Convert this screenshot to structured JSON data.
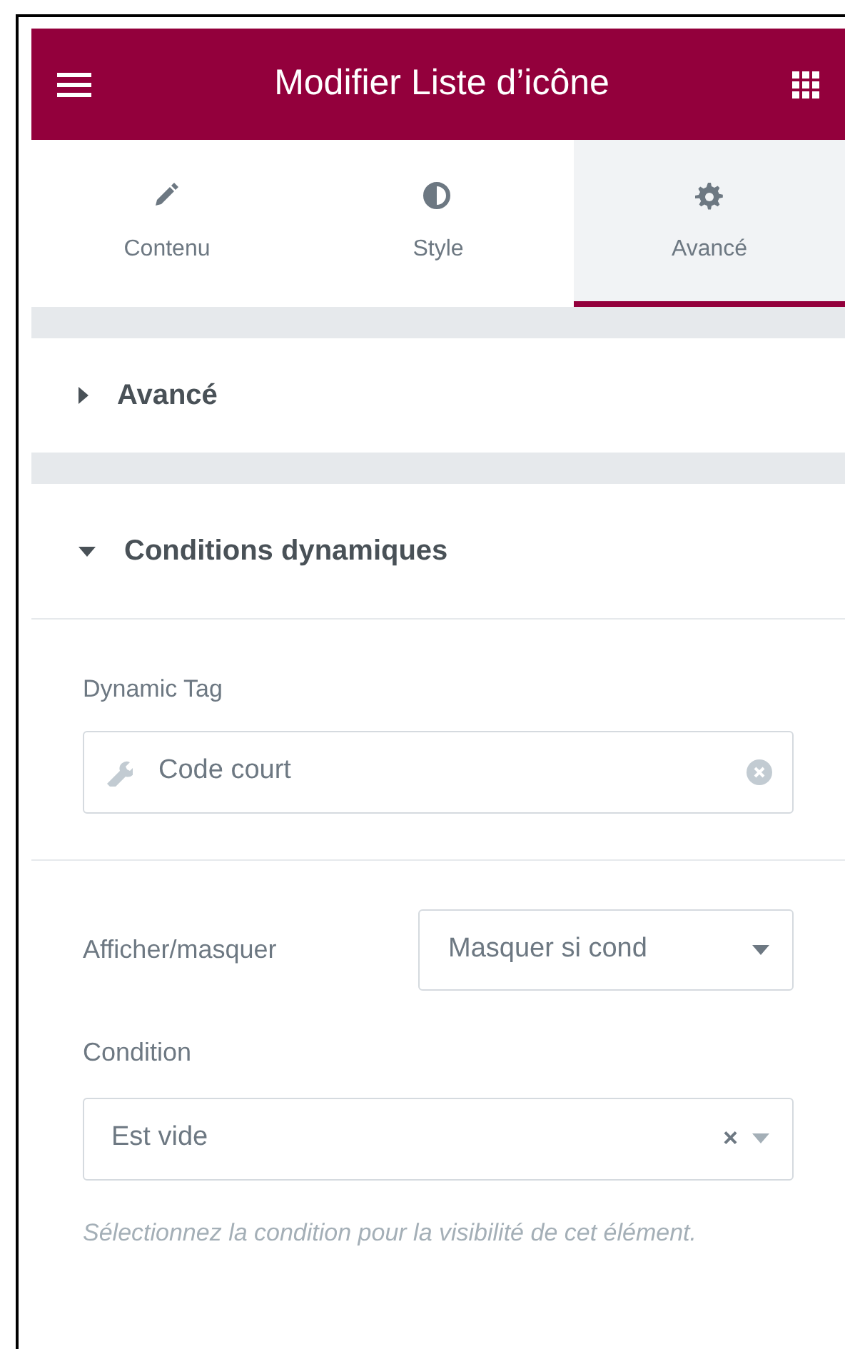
{
  "header": {
    "title": "Modifier Liste d’icône"
  },
  "tabs": [
    {
      "label": "Contenu",
      "selected": false
    },
    {
      "label": "Style",
      "selected": false
    },
    {
      "label": "Avancé",
      "selected": true
    }
  ],
  "sections": [
    {
      "title": "Avancé",
      "expanded": false
    },
    {
      "title": "Conditions dynamiques",
      "expanded": true,
      "controls": [
        {
          "kind": "tag",
          "label": "Dynamic Tag",
          "value": "Code court"
        },
        {
          "kind": "inline-select",
          "label": "Afficher/masquer",
          "value": "Masquer si cond"
        },
        {
          "kind": "select",
          "label": "Condition",
          "value": "Est vide",
          "clear": "×",
          "help": "Sélectionnez la condition pour la visibilité de cet élément."
        }
      ]
    }
  ]
}
